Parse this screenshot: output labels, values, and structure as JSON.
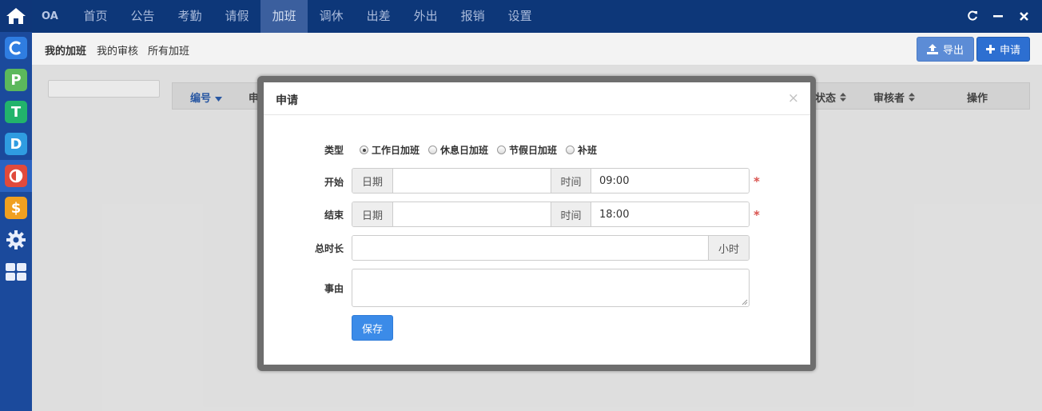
{
  "sidebar": {
    "home_icon": "home-icon",
    "apps": [
      {
        "name": "app-c",
        "glyph": "C",
        "color": "#2f7de1"
      },
      {
        "name": "app-p",
        "glyph": "P",
        "color": "#5cb85c"
      },
      {
        "name": "app-t",
        "glyph": "T",
        "color": "#22b36b"
      },
      {
        "name": "app-d",
        "glyph": "D",
        "color": "#2f9ce1"
      },
      {
        "name": "app-o",
        "glyph": "O",
        "color": "#e14a3c"
      },
      {
        "name": "app-s",
        "glyph": "S",
        "color": "#f0a020"
      }
    ],
    "settings_icon": "gear-icon",
    "grid_icon": "grid-icon"
  },
  "topnav": {
    "brand": "OA",
    "items": [
      "首页",
      "公告",
      "考勤",
      "请假",
      "加班",
      "调休",
      "出差",
      "外出",
      "报销",
      "设置"
    ],
    "active_index": 4,
    "window_controls": [
      "refresh-icon",
      "minimize-icon",
      "close-icon"
    ]
  },
  "subnav": {
    "tabs": [
      "我的加班",
      "我的审核",
      "所有加班"
    ],
    "active_index": 0,
    "export_label": "导出",
    "apply_label": "申请"
  },
  "table": {
    "columns": [
      "编号",
      "申请",
      "状态",
      "审核者",
      "操作"
    ]
  },
  "modal": {
    "title": "申请",
    "close_glyph": "×",
    "type_label": "类型",
    "type_options": [
      "工作日加班",
      "休息日加班",
      "节假日加班",
      "补班"
    ],
    "type_selected": 0,
    "start_label": "开始",
    "end_label": "结束",
    "date_addon": "日期",
    "time_addon": "时间",
    "start_time": "09:00",
    "end_time": "18:00",
    "required_mark": "*",
    "duration_label": "总时长",
    "duration_unit": "小时",
    "reason_label": "事由",
    "save_label": "保存"
  },
  "colors": {
    "nav_bg": "#0d3779",
    "sidebar_bg": "#1b4a9c",
    "primary": "#2d6fd1",
    "required": "#d9534f"
  }
}
